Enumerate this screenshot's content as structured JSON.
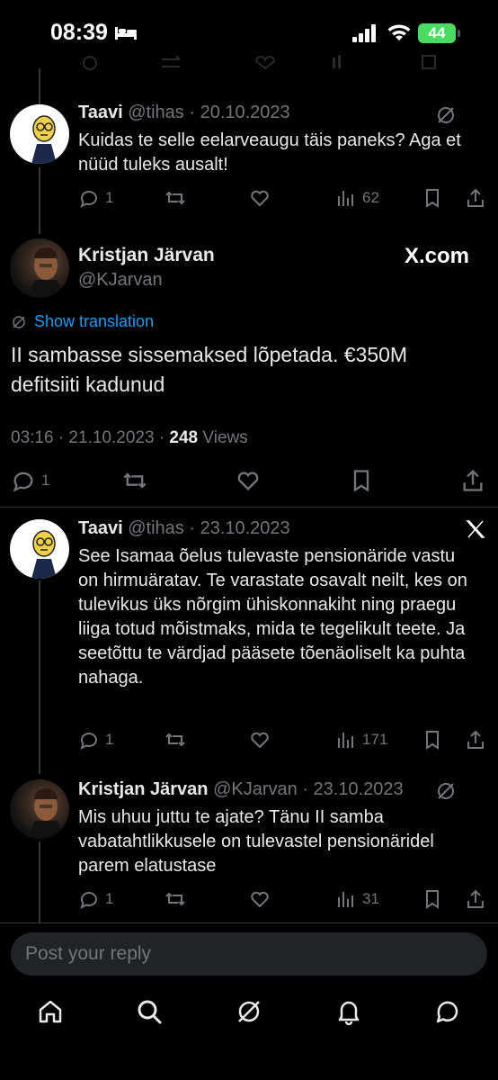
{
  "status_bar": {
    "time": "08:39",
    "battery": "44"
  },
  "tweets": [
    {
      "name": "Taavi",
      "handle": "@tihas",
      "date": "20.10.2023",
      "text": "Kuidas te selle eelarveaugu täis paneks? Aga et nüüd tuleks ausalt!",
      "replies": "1",
      "views": "62"
    },
    {
      "name": "Taavi",
      "handle": "@tihas",
      "date": "23.10.2023",
      "text": "See Isamaa õelus tulevaste pensionäride vastu on hirmuäratav. Te varastate osavalt neilt, kes on tulevikus üks nõrgim ühiskonnakiht ning praegu liiga totud mõistmaks, mida te tegelikult teete. Ja seetõttu te värdjad pääsete tõenäoliselt ka puhta nahaga.",
      "replies": "1",
      "views": "171"
    },
    {
      "name": "Kristjan Järvan",
      "handle": "@KJarvan",
      "date": "23.10.2023",
      "text": "Mis uhuu juttu te ajate? Tänu II samba vabatahtlikkusele on tulevastel pensionäridel parem elatustase",
      "replies": "1",
      "views": "31"
    }
  ],
  "main_tweet": {
    "name": "Kristjan Järvan",
    "handle": "@KJarvan",
    "watermark": "X.com",
    "show_translation": "Show translation",
    "text": "II sambasse sissemaksed lõpetada.  €350M defitsiiti kadunud",
    "time_date": "03:16 · 21.10.2023 · ",
    "views_count": "248",
    "views_label": " Views",
    "replies": "1"
  },
  "separator": " · ",
  "reply_input": {
    "placeholder": "Post your reply"
  },
  "nav": [
    "home-icon",
    "search-icon",
    "grok-icon",
    "notifications-icon",
    "messages-icon"
  ]
}
